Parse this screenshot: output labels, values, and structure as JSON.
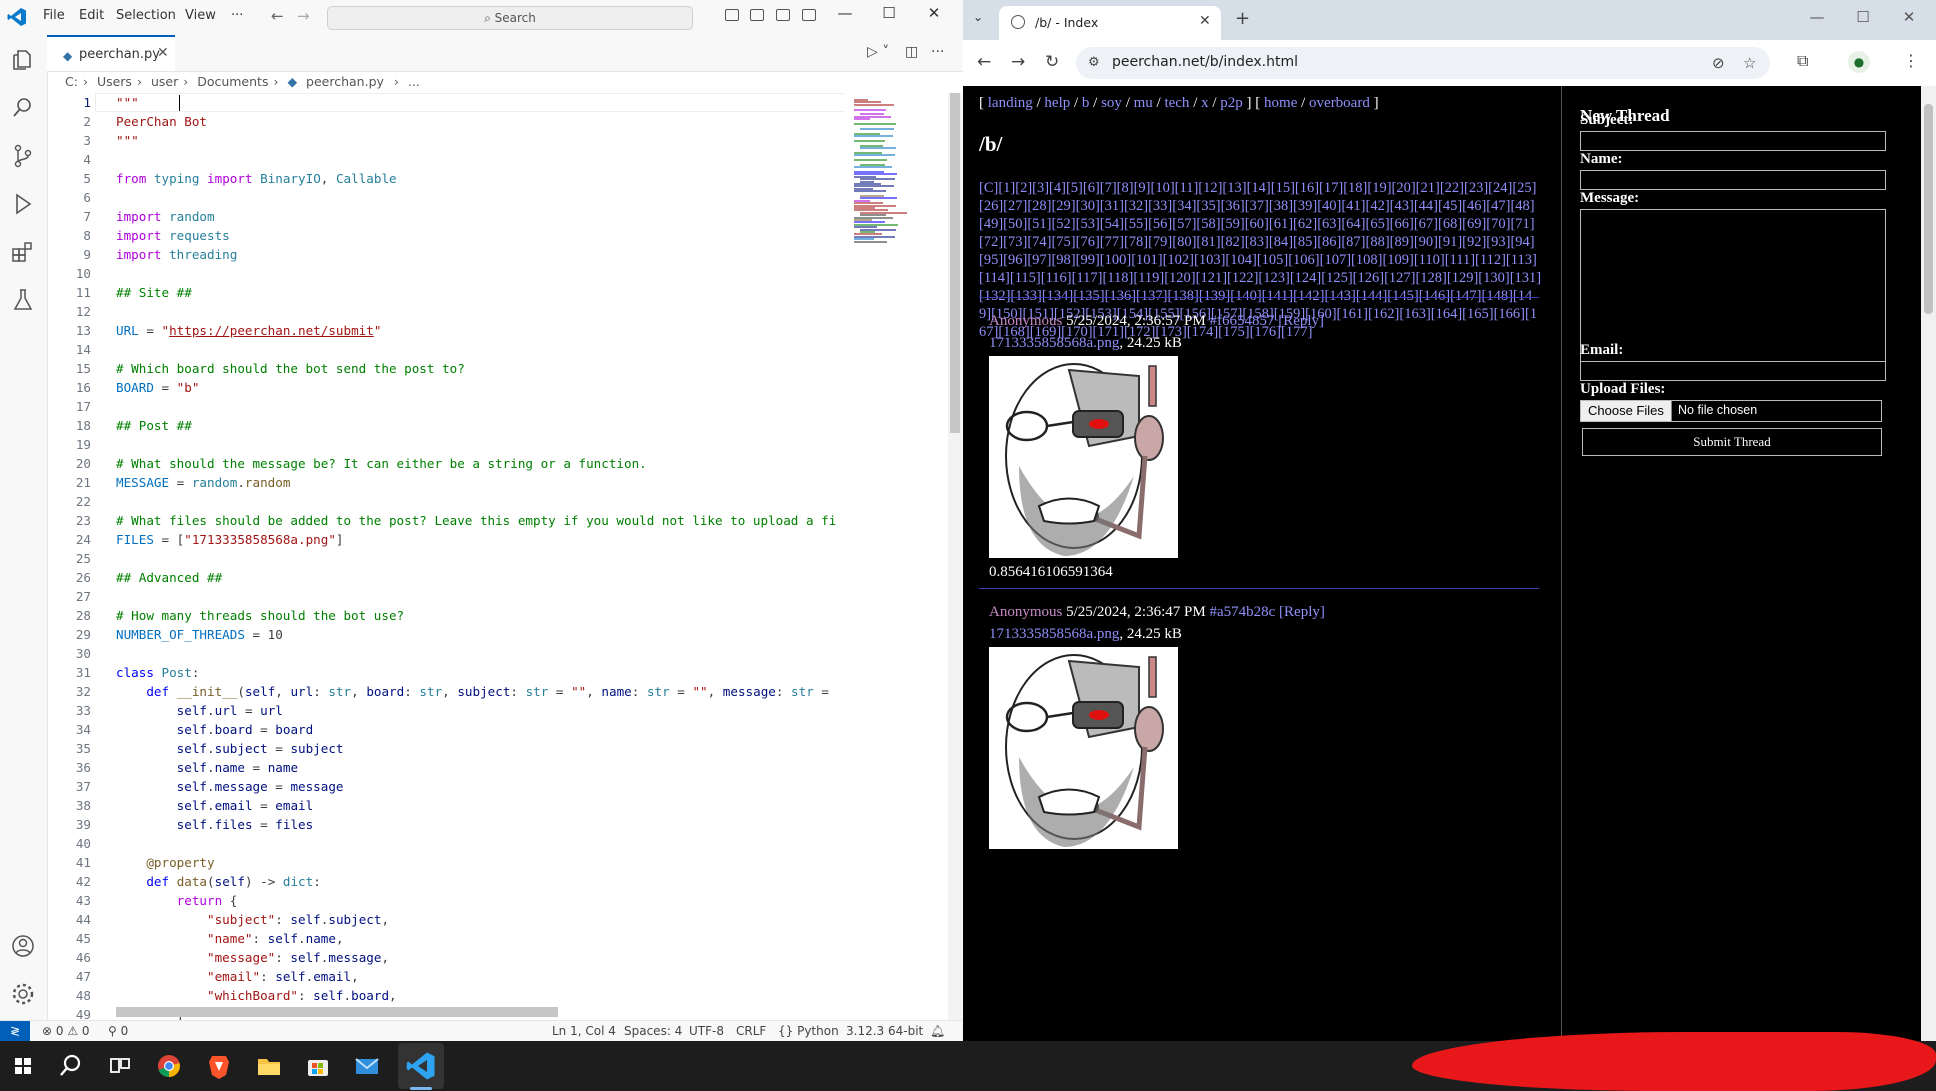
{
  "vscode": {
    "menu": [
      "File",
      "Edit",
      "Selection",
      "View",
      "···"
    ],
    "search_placeholder": "Search",
    "tab_label": "peerchan.py",
    "breadcrumb": [
      "C:",
      "Users",
      "user",
      "Documents",
      "peerchan.py",
      "..."
    ],
    "status": {
      "errors": "0",
      "warnings": "0",
      "ports": "0",
      "position": "Ln 1, Col 4",
      "spaces": "Spaces: 4",
      "encoding": "UTF-8",
      "eol": "CRLF",
      "language": "Python",
      "interpreter": "3.12.3 64-bit"
    },
    "code_lines": [
      {
        "n": "1",
        "html": "<span class=\"s\">\"\"\"</span>"
      },
      {
        "n": "2",
        "html": "<span class=\"s\">PeerChan Bot</span>"
      },
      {
        "n": "3",
        "html": "<span class=\"s\">\"\"\"</span>"
      },
      {
        "n": "4",
        "html": ""
      },
      {
        "n": "5",
        "html": "<span class=\"kw2\">from</span> <span class=\"t\">typing</span> <span class=\"kw2\">import</span> <span class=\"t\">BinaryIO</span>, <span class=\"t\">Callable</span>"
      },
      {
        "n": "6",
        "html": ""
      },
      {
        "n": "7",
        "html": "<span class=\"kw2\">import</span> <span class=\"t\">random</span>"
      },
      {
        "n": "8",
        "html": "<span class=\"kw2\">import</span> <span class=\"t\">requests</span>"
      },
      {
        "n": "9",
        "html": "<span class=\"kw2\">import</span> <span class=\"t\">threading</span>"
      },
      {
        "n": "10",
        "html": ""
      },
      {
        "n": "11",
        "html": "<span class=\"c\">## Site ##</span>"
      },
      {
        "n": "12",
        "html": ""
      },
      {
        "n": "13",
        "html": "<span class=\"v\">URL</span> = <span class=\"s\">\"<u>https://peerchan.net/submit</u>\"</span>"
      },
      {
        "n": "14",
        "html": ""
      },
      {
        "n": "15",
        "html": "<span class=\"c\"># Which board should the bot send the post to?</span>"
      },
      {
        "n": "16",
        "html": "<span class=\"v\">BOARD</span> = <span class=\"s\">\"b\"</span>"
      },
      {
        "n": "17",
        "html": ""
      },
      {
        "n": "18",
        "html": "<span class=\"c\">## Post ##</span>"
      },
      {
        "n": "19",
        "html": ""
      },
      {
        "n": "20",
        "html": "<span class=\"c\"># What should the message be? It can either be a string or a function.</span>"
      },
      {
        "n": "21",
        "html": "<span class=\"v\">MESSAGE</span> = <span class=\"t\">random</span>.<span class=\"f\">random</span>"
      },
      {
        "n": "22",
        "html": ""
      },
      {
        "n": "23",
        "html": "<span class=\"c\"># What files should be added to the post? Leave this empty if you would not like to upload a fi</span>"
      },
      {
        "n": "24",
        "html": "<span class=\"v\">FILES</span> = [<span class=\"s\">\"1713335858568a.png\"</span>]"
      },
      {
        "n": "25",
        "html": ""
      },
      {
        "n": "26",
        "html": "<span class=\"c\">## Advanced ##</span>"
      },
      {
        "n": "27",
        "html": ""
      },
      {
        "n": "28",
        "html": "<span class=\"c\"># How many threads should the bot use?</span>"
      },
      {
        "n": "29",
        "html": "<span class=\"v\">NUMBER_OF_THREADS</span> = 10"
      },
      {
        "n": "30",
        "html": ""
      },
      {
        "n": "31",
        "html": "<span class=\"k\">class</span> <span class=\"t\">Post</span>:"
      },
      {
        "n": "32",
        "html": "    <span class=\"k\">def</span> <span class=\"f\">__init__</span>(<span class=\"p\">self</span>, <span class=\"p\">url</span>: <span class=\"t\">str</span>, <span class=\"p\">board</span>: <span class=\"t\">str</span>, <span class=\"p\">subject</span>: <span class=\"t\">str</span> = <span class=\"s\">\"\"</span>, <span class=\"p\">name</span>: <span class=\"t\">str</span> = <span class=\"s\">\"\"</span>, <span class=\"p\">message</span>: <span class=\"t\">str</span> ="
      },
      {
        "n": "33",
        "html": "        <span class=\"p\">self</span>.<span class=\"p\">url</span> = <span class=\"p\">url</span>"
      },
      {
        "n": "34",
        "html": "        <span class=\"p\">self</span>.<span class=\"p\">board</span> = <span class=\"p\">board</span>"
      },
      {
        "n": "35",
        "html": "        <span class=\"p\">self</span>.<span class=\"p\">subject</span> = <span class=\"p\">subject</span>"
      },
      {
        "n": "36",
        "html": "        <span class=\"p\">self</span>.<span class=\"p\">name</span> = <span class=\"p\">name</span>"
      },
      {
        "n": "37",
        "html": "        <span class=\"p\">self</span>.<span class=\"p\">message</span> = <span class=\"p\">message</span>"
      },
      {
        "n": "38",
        "html": "        <span class=\"p\">self</span>.<span class=\"p\">email</span> = <span class=\"p\">email</span>"
      },
      {
        "n": "39",
        "html": "        <span class=\"p\">self</span>.<span class=\"p\">files</span> = <span class=\"p\">files</span>"
      },
      {
        "n": "40",
        "html": ""
      },
      {
        "n": "41",
        "html": "    <span class=\"f\">@property</span>"
      },
      {
        "n": "42",
        "html": "    <span class=\"k\">def</span> <span class=\"f\">data</span>(<span class=\"p\">self</span>) -&gt; <span class=\"t\">dict</span>:"
      },
      {
        "n": "43",
        "html": "        <span class=\"kw2\">return</span> {"
      },
      {
        "n": "44",
        "html": "            <span class=\"s\">\"subject\"</span>: <span class=\"p\">self</span>.<span class=\"p\">subject</span>,"
      },
      {
        "n": "45",
        "html": "            <span class=\"s\">\"name\"</span>: <span class=\"p\">self</span>.<span class=\"p\">name</span>,"
      },
      {
        "n": "46",
        "html": "            <span class=\"s\">\"message\"</span>: <span class=\"p\">self</span>.<span class=\"p\">message</span>,"
      },
      {
        "n": "47",
        "html": "            <span class=\"s\">\"email\"</span>: <span class=\"p\">self</span>.<span class=\"p\">email</span>,"
      },
      {
        "n": "48",
        "html": "            <span class=\"s\">\"whichBoard\"</span>: <span class=\"p\">self</span>.<span class=\"p\">board</span>,"
      },
      {
        "n": "49",
        "html": "        }"
      }
    ]
  },
  "browser": {
    "tab_title": "/b/ - Index",
    "url": "peerchan.net/b/index.html",
    "page": {
      "nav_groups": [
        [
          "landing",
          "help",
          "b",
          "soy",
          "mu",
          "tech",
          "x",
          "p2p"
        ],
        [
          "home",
          "overboard"
        ]
      ],
      "board_title": "/b/",
      "pages_text": "[C][1][2][3][4][5][6][7][8][9][10][11][12][13][14][15][16][17][18][19][20][21][22][23][24][25][26][27][28][29][30][31][32][33][34][35][36][37][38][39][40][41][42][43][44][45][46][47][48][49][50][51][52][53][54][55][56][57][58][59][60][61][62][63][64][65][66][67][68][69][70][71][72][73][74][75][76][77][78][79][80][81][82][83][84][85][86][87][88][89][90][91][92][93][94][95][96][97][98][99][100][101][102][103][104][105][106][107][108][109][110][111][112][113][114][115][116][117][118][119][120][121][122][123][124][125][126][127][128][129][130][131][132][133][134][135][136][137][138][139][140][141][142][143][144][145][146][147][148][149][150][151][152][153][154][155][156][157][158][159][160][161][162][163][164][165][166][167][168][169][170][171][172][173][174][175][176][177]",
      "posts": [
        {
          "name": "Anonymous",
          "date": "5/25/2024, 2:36:57 PM",
          "id": "#f6654857",
          "reply": "[Reply]",
          "file": "1713335858568a.png",
          "size": ", 24.25 kB",
          "message": "0.856416106591364"
        },
        {
          "name": "Anonymous",
          "date": "5/25/2024, 2:36:47 PM",
          "id": "#a574b28c",
          "reply": "[Reply]",
          "file": "1713335858568a.png",
          "size": ", 24.25 kB",
          "message": ""
        }
      ],
      "form": {
        "title": "New Thread",
        "subject": "Subject:",
        "name": "Name:",
        "message": "Message:",
        "email": "Email:",
        "upload": "Upload Files:",
        "choose": "Choose Files",
        "no_file": "No file chosen",
        "submit": "Submit Thread"
      }
    }
  },
  "taskbar": {
    "icons": [
      "windows-start-icon",
      "search-icon",
      "task-view-icon",
      "chrome-icon",
      "brave-icon",
      "file-explorer-icon",
      "store-icon",
      "mail-icon",
      "vscode-icon"
    ]
  }
}
